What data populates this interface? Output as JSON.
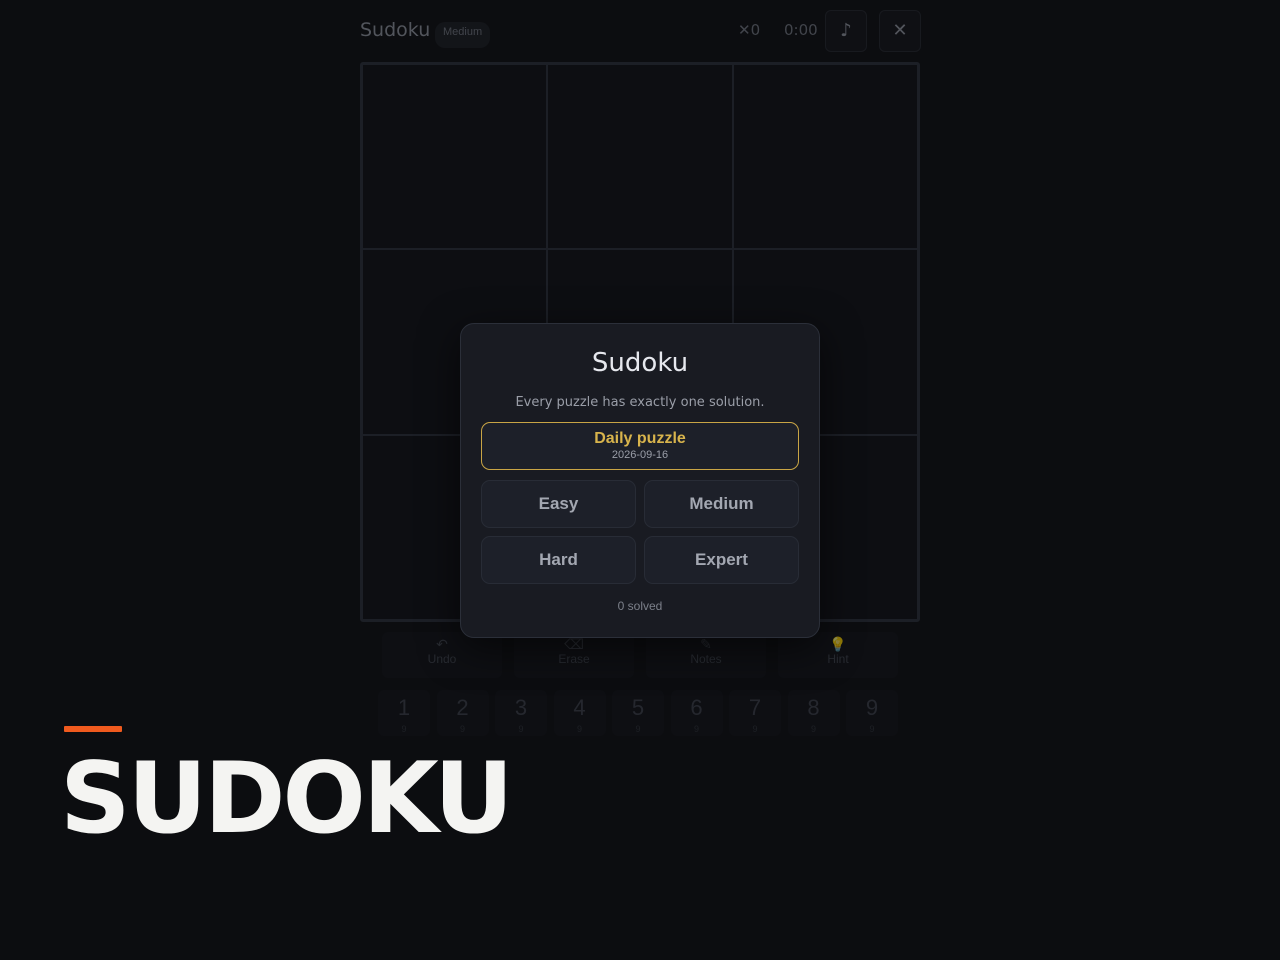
{
  "header": {
    "title": "Sudoku",
    "difficulty_badge": "Medium",
    "mistakes": "✕0",
    "timer": "0:00",
    "music_icon": "♪",
    "close_icon": "✕"
  },
  "tools": [
    {
      "label": "Undo",
      "icon": "↶"
    },
    {
      "label": "Erase",
      "icon": "⌫"
    },
    {
      "label": "Notes",
      "icon": "✎"
    },
    {
      "label": "Hint",
      "icon": "💡"
    }
  ],
  "numpad": [
    {
      "digit": "1",
      "count": "9"
    },
    {
      "digit": "2",
      "count": "9"
    },
    {
      "digit": "3",
      "count": "9"
    },
    {
      "digit": "4",
      "count": "9"
    },
    {
      "digit": "5",
      "count": "9"
    },
    {
      "digit": "6",
      "count": "9"
    },
    {
      "digit": "7",
      "count": "9"
    },
    {
      "digit": "8",
      "count": "9"
    },
    {
      "digit": "9",
      "count": "9"
    }
  ],
  "modal": {
    "title": "Sudoku",
    "subtitle": "Every puzzle has exactly one solution.",
    "daily": {
      "label": "Daily puzzle",
      "date": "2026-09-16"
    },
    "difficulties": [
      "Easy",
      "Medium",
      "Hard",
      "Expert"
    ],
    "solved": "0 solved"
  },
  "brand": {
    "wordmark": "SUDOKU",
    "accent_color": "#f05a1e"
  },
  "colors": {
    "background": "#0c0d10",
    "modal_bg": "#191b22",
    "daily_gold": "#d8b44c"
  }
}
